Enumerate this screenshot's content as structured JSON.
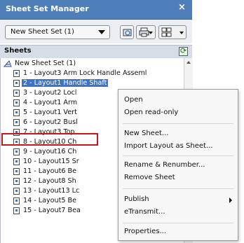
{
  "window": {
    "title": "Sheet Set Manager",
    "close": "×"
  },
  "toolbar": {
    "combo_value": "New Sheet Set (1)"
  },
  "sheets_header": {
    "label": "Sheets"
  },
  "tree": {
    "root": "New Sheet Set (1)",
    "items": [
      "1 - Layout3 Arm Lock Handle Asseml",
      "2 - Layout1 Handle Shaft",
      "3 - Layout2 Locl",
      "4 - Layout1 Arm",
      "5 - Layout1 Vert",
      "6 - Layout2 Busl",
      "7 - Layout3 Top",
      "8 - Layout10 Ch",
      "9 - Layout16 Ch",
      "10 - Layout15 Sr",
      "11 - Layout6 Be",
      "12 - Layout8 Sh",
      "13 - Layout13 Lc",
      "14 - Layout5 Be",
      "15 - Layout7 Bea"
    ],
    "selected_index": 1
  },
  "context_menu": {
    "items": [
      {
        "label": "Open"
      },
      {
        "label": "Open read-only"
      },
      {
        "label": "New Sheet..."
      },
      {
        "label": "Import Layout as Sheet...",
        "highlighted": true
      },
      {
        "label": "Rename & Renumber..."
      },
      {
        "label": "Remove Sheet"
      },
      {
        "label": "Publish",
        "submenu": true
      },
      {
        "label": "eTransmit..."
      },
      {
        "label": "Properties..."
      }
    ]
  },
  "colors": {
    "title_bar": "#4f7fb8",
    "selection": "#3d74c6",
    "highlight_box": "#c8161d"
  }
}
